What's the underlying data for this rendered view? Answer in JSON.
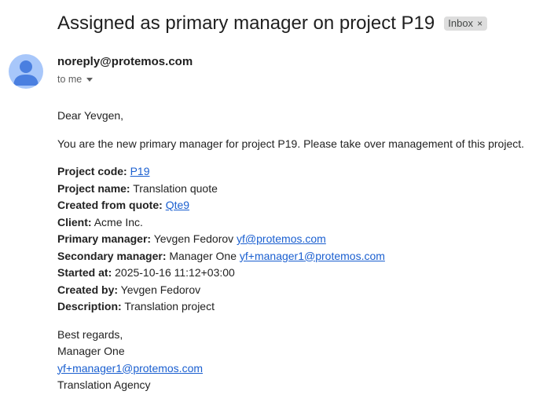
{
  "subject": "Assigned as primary manager on project P19",
  "badge": {
    "label": "Inbox",
    "close": "×"
  },
  "sender": {
    "email": "noreply@protemos.com",
    "to": "to me"
  },
  "body": {
    "greeting": "Dear Yevgen,",
    "intro": "You are the new primary manager for project P19. Please take over management of this project.",
    "details": {
      "project_code": {
        "label": "Project code:",
        "link": "P19"
      },
      "project_name": {
        "label": "Project name:",
        "value": "Translation quote"
      },
      "created_from_quote": {
        "label": "Created from quote:",
        "link": "Qte9"
      },
      "client": {
        "label": "Client:",
        "value": "Acme Inc."
      },
      "primary_manager": {
        "label": "Primary manager:",
        "value": "Yevgen Fedorov",
        "link": "yf@protemos.com"
      },
      "secondary_manager": {
        "label": "Secondary manager:",
        "value": "Manager One",
        "link": "yf+manager1@protemos.com"
      },
      "started_at": {
        "label": "Started at:",
        "value": "2025-10-16 11:12+03:00"
      },
      "created_by": {
        "label": "Created by:",
        "value": "Yevgen Fedorov"
      },
      "description": {
        "label": "Description:",
        "value": "Translation project"
      }
    },
    "signature": {
      "closing": "Best regards,",
      "name": "Manager One",
      "email": "yf+manager1@protemos.com",
      "company": "Translation Agency"
    }
  },
  "colors": {
    "link": "#1a5fd0",
    "avatar_bg": "#a8c7fa",
    "avatar_fg": "#4a7fe0",
    "badge_bg": "#dddddd"
  },
  "icons": {
    "avatar": "person-avatar-icon",
    "caret": "caret-down-icon",
    "badge_close": "close-icon"
  }
}
